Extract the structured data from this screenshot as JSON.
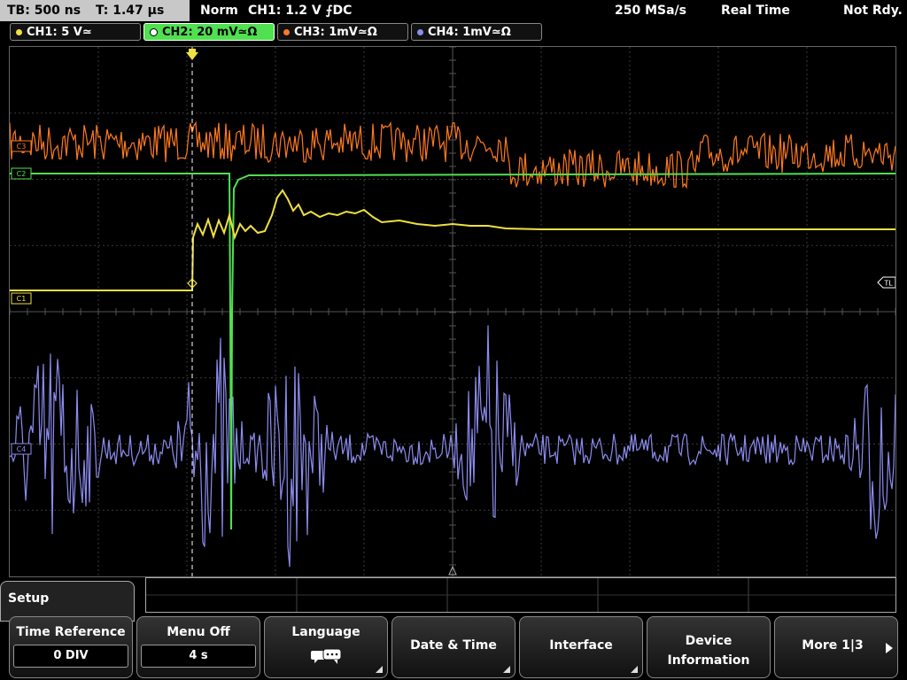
{
  "status": {
    "timebase": "TB: 500 ns",
    "trigger_time": "T: 1.47 µs",
    "mode": "Norm",
    "trigger_cfg": "CH1: 1.2 V ⨍DC",
    "sample_rate": "250 MSa/s",
    "acq_mode": "Real Time",
    "state": "Not Rdy."
  },
  "channels": [
    {
      "label": "CH1: 5 V≃",
      "color": "#f0e040",
      "active": false
    },
    {
      "label": "CH2: 20 mV≃Ω",
      "color": "#50e050",
      "active": true
    },
    {
      "label": "CH3: 1mV≃Ω",
      "color": "#ff7a1e",
      "active": false
    },
    {
      "label": "CH4: 1mV≃Ω",
      "color": "#8c8cf0",
      "active": false
    }
  ],
  "markers": {
    "ch3": "C3",
    "ch2": "C2",
    "ch1": "C1",
    "ch4": "C4",
    "trigger_level": "TL"
  },
  "menu": {
    "title": "Setup",
    "softkeys": [
      {
        "label": "Time Reference",
        "value": "0 DIV"
      },
      {
        "label": "Menu Off",
        "value": "4 s"
      },
      {
        "label": "Language",
        "icon": "speech-bubble-icon",
        "submenu": true
      },
      {
        "label": "Date & Time",
        "submenu": true
      },
      {
        "label": "Interface",
        "submenu": true
      },
      {
        "label_line1": "Device",
        "label_line2": "Information"
      },
      {
        "label": "More 1|3",
        "icon": "arrow-right-icon"
      }
    ]
  },
  "colors": {
    "ch1": "#f0e040",
    "ch2": "#50e050",
    "ch3": "#ff7a1e",
    "ch4": "#8c8cf0",
    "grid": "#555555"
  }
}
